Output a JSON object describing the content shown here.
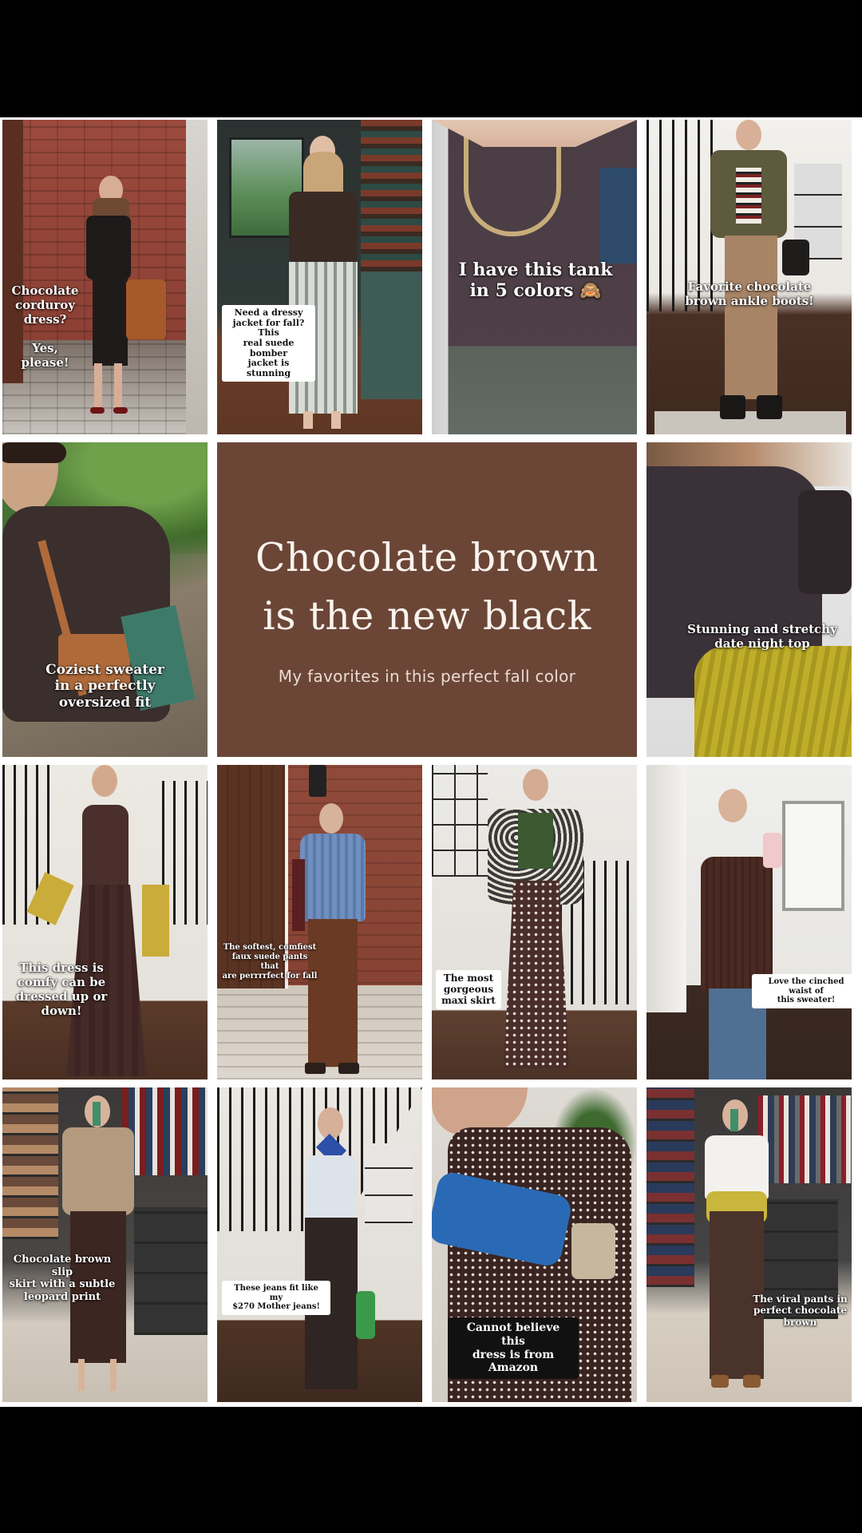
{
  "colors": {
    "background": "#000000",
    "title_panel": "#6b4637",
    "title_text": "#fbf4ee"
  },
  "header": {
    "title": "Chocolate brown is the new black",
    "subtitle": "My favorites in this perfect fall color"
  },
  "tiles": [
    {
      "caption": "Chocolate\ncorduroy\ndress?\n\nYes, please!"
    },
    {
      "caption": "Need a dressy\njacket for fall? This\nreal suede bomber\njacket is stunning"
    },
    {
      "caption": "I have this tank\nin 5 colors 🙈"
    },
    {
      "caption": "Favorite chocolate\nbrown ankle boots!"
    },
    {
      "caption": "Coziest sweater\nin a perfectly\noversized fit"
    },
    {
      "caption": "Stunning and stretchy\ndate night top"
    },
    {
      "caption": "This dress is\ncomfy can be\ndressed up or\ndown!"
    },
    {
      "caption": "The softest, comfiest\nfaux suede pants that\nare perrrrfect for fall"
    },
    {
      "caption": "The most\ngorgeous\nmaxi skirt"
    },
    {
      "caption": "Love the cinched waist of\nthis sweater!"
    },
    {
      "caption": "Chocolate brown slip\nskirt with a subtle\nleopard print"
    },
    {
      "caption": "These jeans fit like my\n$270 Mother jeans!"
    },
    {
      "caption": "Cannot believe this\ndress is from Amazon"
    },
    {
      "caption": "The viral pants in\nperfect chocolate\nbrown"
    }
  ]
}
